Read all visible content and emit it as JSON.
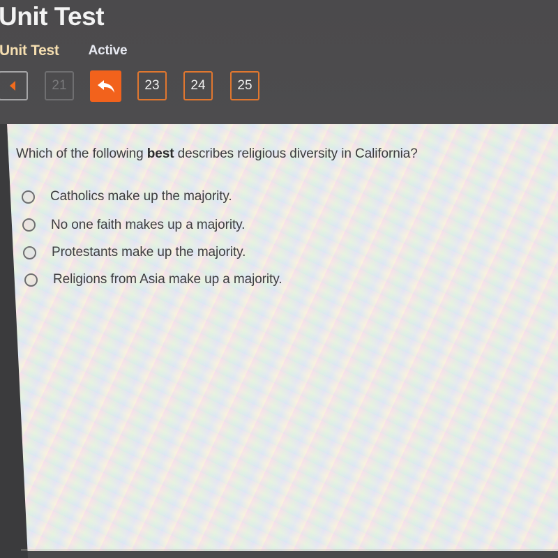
{
  "app": {
    "title": "Unit Test"
  },
  "subnav": {
    "title": "Unit Test",
    "status": "Active"
  },
  "question_nav": {
    "prev_icon": "caret-left-icon",
    "items": [
      {
        "label": "21",
        "state": "disabled"
      },
      {
        "label": "",
        "state": "current",
        "icon": "reply-arrow-icon"
      },
      {
        "label": "23",
        "state": "available"
      },
      {
        "label": "24",
        "state": "available"
      },
      {
        "label": "25",
        "state": "available"
      }
    ],
    "accent_color": "#f2621c"
  },
  "question": {
    "text_before": "Which of the following ",
    "text_bold": "best",
    "text_after": " describes religious diversity in California?",
    "options": [
      {
        "label": "Catholics make up the majority.",
        "selected": false
      },
      {
        "label": "No one faith makes up a majority.",
        "selected": false
      },
      {
        "label": "Protestants make up the majority.",
        "selected": false
      },
      {
        "label": "Religions from Asia make up a majority.",
        "selected": false
      }
    ]
  }
}
